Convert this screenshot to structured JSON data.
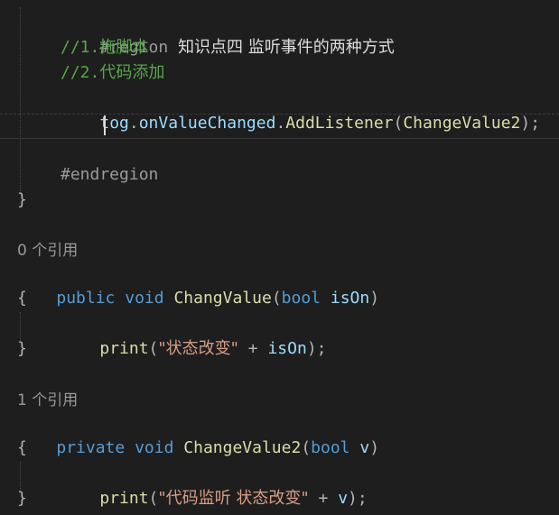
{
  "code": {
    "region": {
      "keyword": "#region",
      "title": "知识点四 监听事件的两种方式"
    },
    "comment1": "//1.拖脚本",
    "comment2": "//2.代码添加",
    "listener_line": {
      "obj": "tog",
      "dot1": ".",
      "member": "onValueChanged",
      "dot2": ".",
      "method": "AddListener",
      "open": "(",
      "arg": "ChangeValue2",
      "close": ");"
    },
    "endregion": "#endregion",
    "close_brace_1": "}",
    "ref1": "0 个引用",
    "method1": {
      "modifier": "public",
      "ret": "void",
      "name": "ChangValue",
      "open": "(",
      "ptype": "bool",
      "pname": "isOn",
      "close": ")"
    },
    "open_brace_2": "{",
    "body1": {
      "fn": "print",
      "open": "(",
      "str": "\"状态改变\"",
      "plus": " + ",
      "arg": "isOn",
      "close": ");"
    },
    "close_brace_2": "}",
    "ref2": "1 个引用",
    "method2": {
      "modifier": "private",
      "ret": "void",
      "name": "ChangeValue2",
      "open": "(",
      "ptype": "bool",
      "pname": "v",
      "close": ")"
    },
    "open_brace_3": "{",
    "body2": {
      "fn": "print",
      "open": "(",
      "str": "\"代码监听 状态改变\"",
      "plus": " + ",
      "arg": "v",
      "close": ");"
    },
    "close_brace_3": "}"
  },
  "colors": {
    "background": "#1e1e1e",
    "keyword": "#569cd6",
    "comment": "#57a64a",
    "string": "#d69d85",
    "method": "#dcdcaa",
    "parameter": "#9cdcfe"
  }
}
